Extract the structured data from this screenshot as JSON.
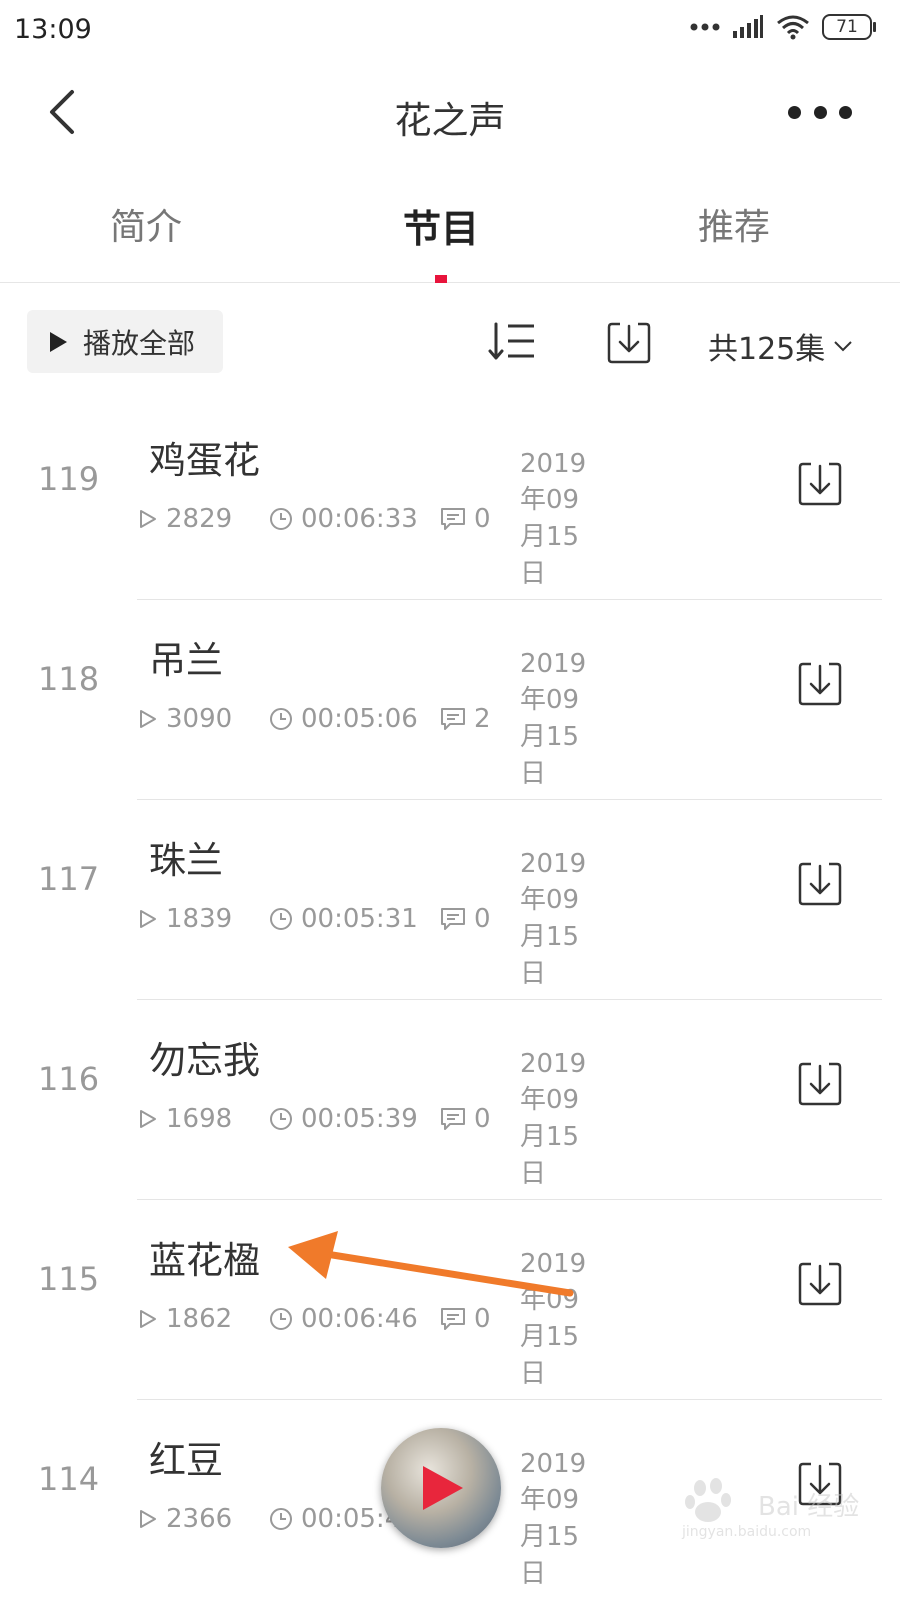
{
  "status_bar": {
    "time": "13:09",
    "battery": "71"
  },
  "nav": {
    "title": "花之声"
  },
  "tabs": [
    {
      "label": "简介",
      "active": false
    },
    {
      "label": "节目",
      "active": true
    },
    {
      "label": "推荐",
      "active": false
    }
  ],
  "accent_color": "#e8143c",
  "toolbar": {
    "play_all": "播放全部",
    "count": "共125集"
  },
  "episodes": [
    {
      "index": "119",
      "title": "鸡蛋花",
      "plays": "2829",
      "duration": "00:06:33",
      "comments": "0",
      "date": "2019年09月15日"
    },
    {
      "index": "118",
      "title": "吊兰",
      "plays": "3090",
      "duration": "00:05:06",
      "comments": "2",
      "date": "2019年09月15日"
    },
    {
      "index": "117",
      "title": "珠兰",
      "plays": "1839",
      "duration": "00:05:31",
      "comments": "0",
      "date": "2019年09月15日"
    },
    {
      "index": "116",
      "title": "勿忘我",
      "plays": "1698",
      "duration": "00:05:39",
      "comments": "0",
      "date": "2019年09月15日"
    },
    {
      "index": "115",
      "title": "蓝花楹",
      "plays": "1862",
      "duration": "00:06:46",
      "comments": "0",
      "date": "2019年09月15日"
    },
    {
      "index": "114",
      "title": "红豆",
      "plays": "2366",
      "duration": "00:05:4",
      "comments": "",
      "date": "2019年09月15日"
    }
  ],
  "watermark": {
    "text": "Bai 经验",
    "sub": "jingyan.baidu.com"
  }
}
